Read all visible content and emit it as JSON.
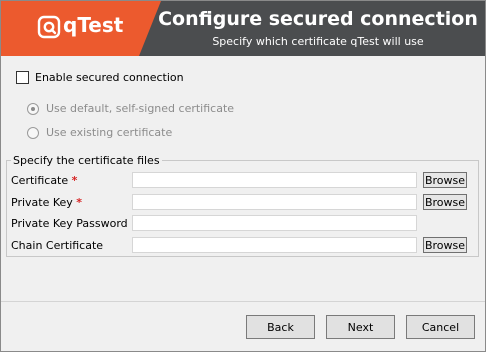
{
  "header": {
    "brand_name": "qTest",
    "title": "Configure secured connection",
    "subtitle": "Specify which certificate qTest will use",
    "colors": {
      "brand_bg": "#ec5a2e",
      "header_bg": "#4b4d4f"
    }
  },
  "enable": {
    "label": "Enable secured connection",
    "checked": false
  },
  "options": {
    "default_label": "Use default, self-signed certificate",
    "existing_label": "Use existing certificate",
    "selected": "default"
  },
  "cert_files": {
    "legend": "Specify the certificate files",
    "certificate_label": "Certificate",
    "private_key_label": "Private Key",
    "private_key_password_label": "Private Key Password",
    "chain_certificate_label": "Chain Certificate",
    "required_marker": "*",
    "certificate_value": "",
    "private_key_value": "",
    "private_key_password_value": "",
    "chain_certificate_value": "",
    "browse_label": "Browse"
  },
  "footer": {
    "back_label": "Back",
    "next_label": "Next",
    "cancel_label": "Cancel"
  }
}
